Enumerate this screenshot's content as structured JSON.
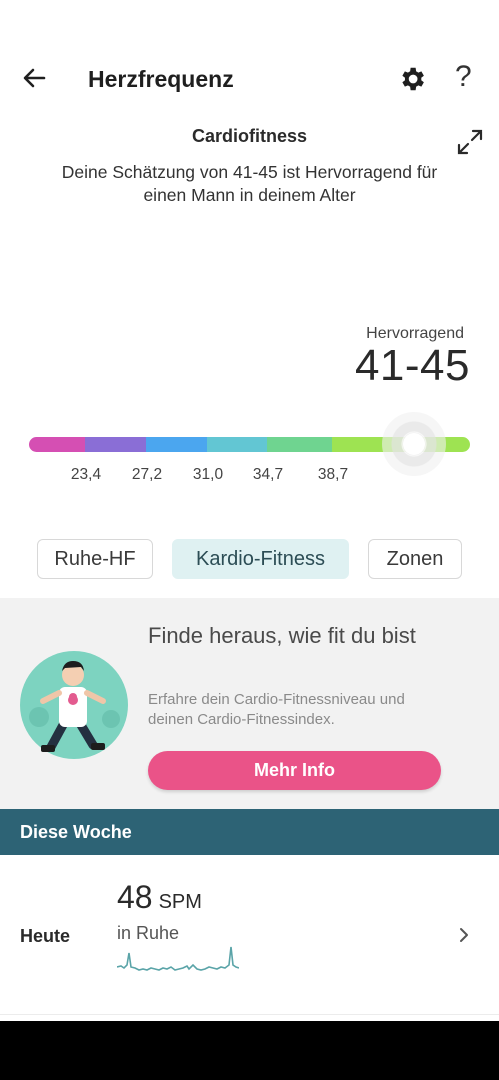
{
  "header": {
    "title": "Herzfrequenz",
    "back_icon": "arrow-left-icon",
    "settings_icon": "gear-icon",
    "help_label": "?"
  },
  "cardio": {
    "section_title": "Cardiofitness",
    "description": "Deine Schätzung von 41-45 ist Hervorragend für einen Mann in deinem Alter",
    "rating_label": "Hervorragend",
    "rating_value": "41-45",
    "ticks": [
      "23,4",
      "27,2",
      "31,0",
      "34,7",
      "38,7"
    ],
    "scale_colors": [
      "#d54fb3",
      "#8a6ed6",
      "#4ba6ef",
      "#62c6d3",
      "#6fd490",
      "#9ee352"
    ]
  },
  "tabs": [
    {
      "label": "Ruhe-HF",
      "active": false
    },
    {
      "label": "Kardio-Fitness",
      "active": true
    },
    {
      "label": "Zonen",
      "active": false
    }
  ],
  "promo": {
    "title": "Finde heraus, wie fit du bist",
    "text": "Erfahre dein Cardio-Fitnessniveau und deinen Cardio-Fitnessindex.",
    "button_label": "Mehr Info"
  },
  "week": {
    "header": "Diese Woche",
    "rows": [
      {
        "day": "Heute",
        "value": "48",
        "unit": "SPM",
        "sub": "in Ruhe"
      }
    ]
  },
  "colors": {
    "accent_pink": "#ea5388",
    "week_header_bg": "#2d6375",
    "active_tab_bg": "#dff1f2",
    "sparkline": "#5aa4a8"
  }
}
